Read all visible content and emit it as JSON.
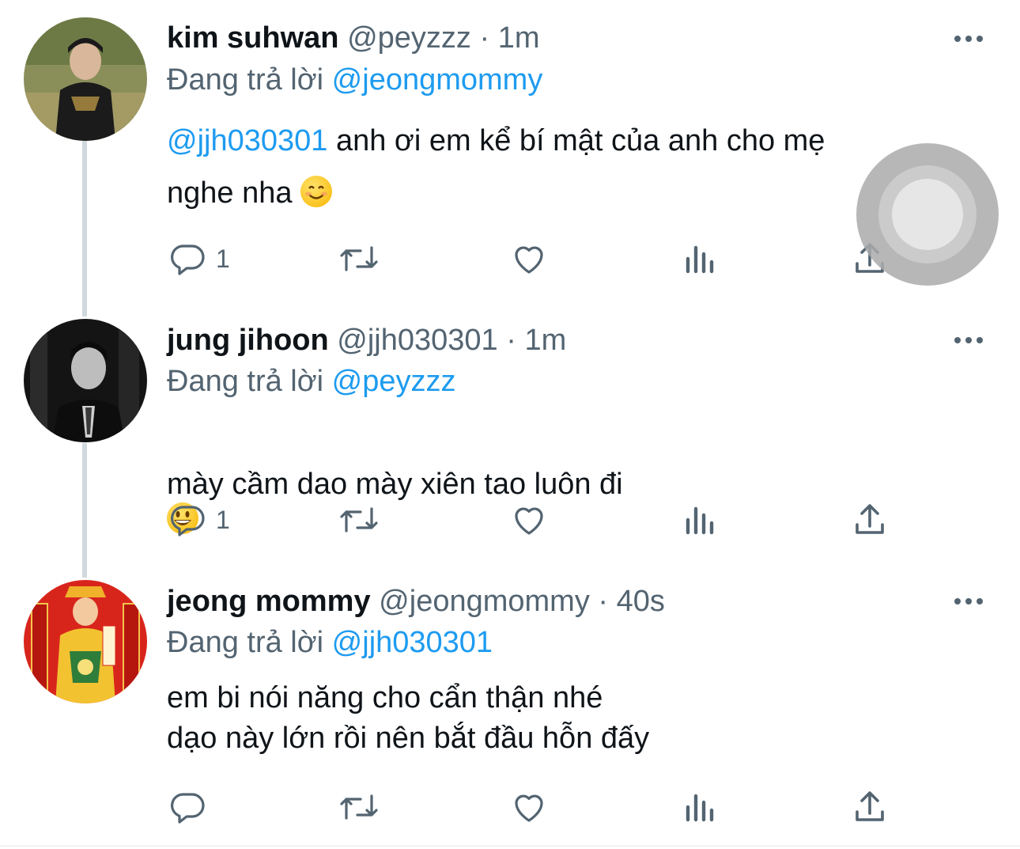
{
  "tweets": [
    {
      "name": "kim suhwan",
      "handle": "@peyzzz",
      "sep": "·",
      "time": "1m",
      "replying_prefix": "Đang trả lời",
      "replying_to": "@jeongmommy",
      "mention": "@jjh030301",
      "text_line1": " anh ơi em kể bí mật của anh cho mẹ",
      "text_line2": "nghe nha",
      "emoji": "smiling-face-icon",
      "reply_count": "1"
    },
    {
      "name": "jung jihoon",
      "handle": "@jjh030301",
      "sep": "·",
      "time": "1m",
      "replying_prefix": "Đang trả lời",
      "replying_to": "@peyzzz",
      "text": "mày cầm dao mày xiên tao luôn đi",
      "emoji": "grinning-face-icon",
      "reply_count": "1"
    },
    {
      "name": "jeong mommy",
      "handle": "@jeongmommy",
      "sep": "·",
      "time": "40s",
      "replying_prefix": "Đang trả lời",
      "replying_to": "@jjh030301",
      "text": "em bi nói năng cho cẩn thận nhé\ndạo này lớn rồi nên bắt đầu hỗn đấy",
      "reply_count": ""
    }
  ],
  "colors": {
    "link": "#1d9bf0",
    "secondary": "#536471",
    "text": "#0f1419",
    "thread_line": "#cfd9de"
  }
}
